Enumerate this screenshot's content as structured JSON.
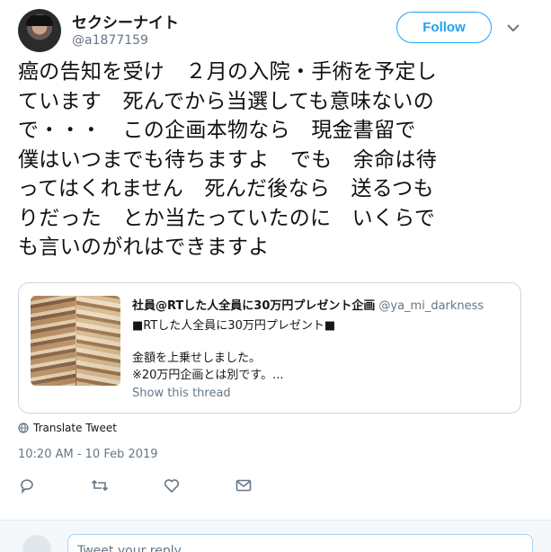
{
  "user": {
    "display_name": "セクシーナイト",
    "handle": "@a1877159"
  },
  "follow_label": "Follow",
  "tweet": {
    "lines": [
      "癌の告知を受け　２月の入院・手術を予定し",
      "ています　死んでから当選しても意味ないの",
      "で・・・　この企画本物なら　現金書留で",
      "僕はいつまでも待ちますよ　でも　余命は待",
      "ってはくれません　死んだ後なら　送るつも",
      "りだった　とか当たっていたのに　いくらで",
      "も言いのがれはできますよ"
    ]
  },
  "quote": {
    "name": "社員@RTした人全員に30万円プレゼント企画",
    "handle": "@ya_mi_darkness",
    "line1": "■RTした人全員に30万円プレゼント■",
    "line2": "金額を上乗せしました。",
    "line3": "※20万円企画とは別です。...",
    "show_thread": "Show this thread"
  },
  "translate_label": "Translate Tweet",
  "timestamp": "10:20 AM - 10 Feb 2019",
  "reply_placeholder": "Tweet your reply",
  "colors": {
    "accent": "#1da1f2",
    "muted": "#657786",
    "border": "#ccd6dd"
  },
  "icons": [
    "caret-down-icon",
    "globe-icon",
    "reply-icon",
    "retweet-icon",
    "like-icon",
    "message-icon"
  ]
}
